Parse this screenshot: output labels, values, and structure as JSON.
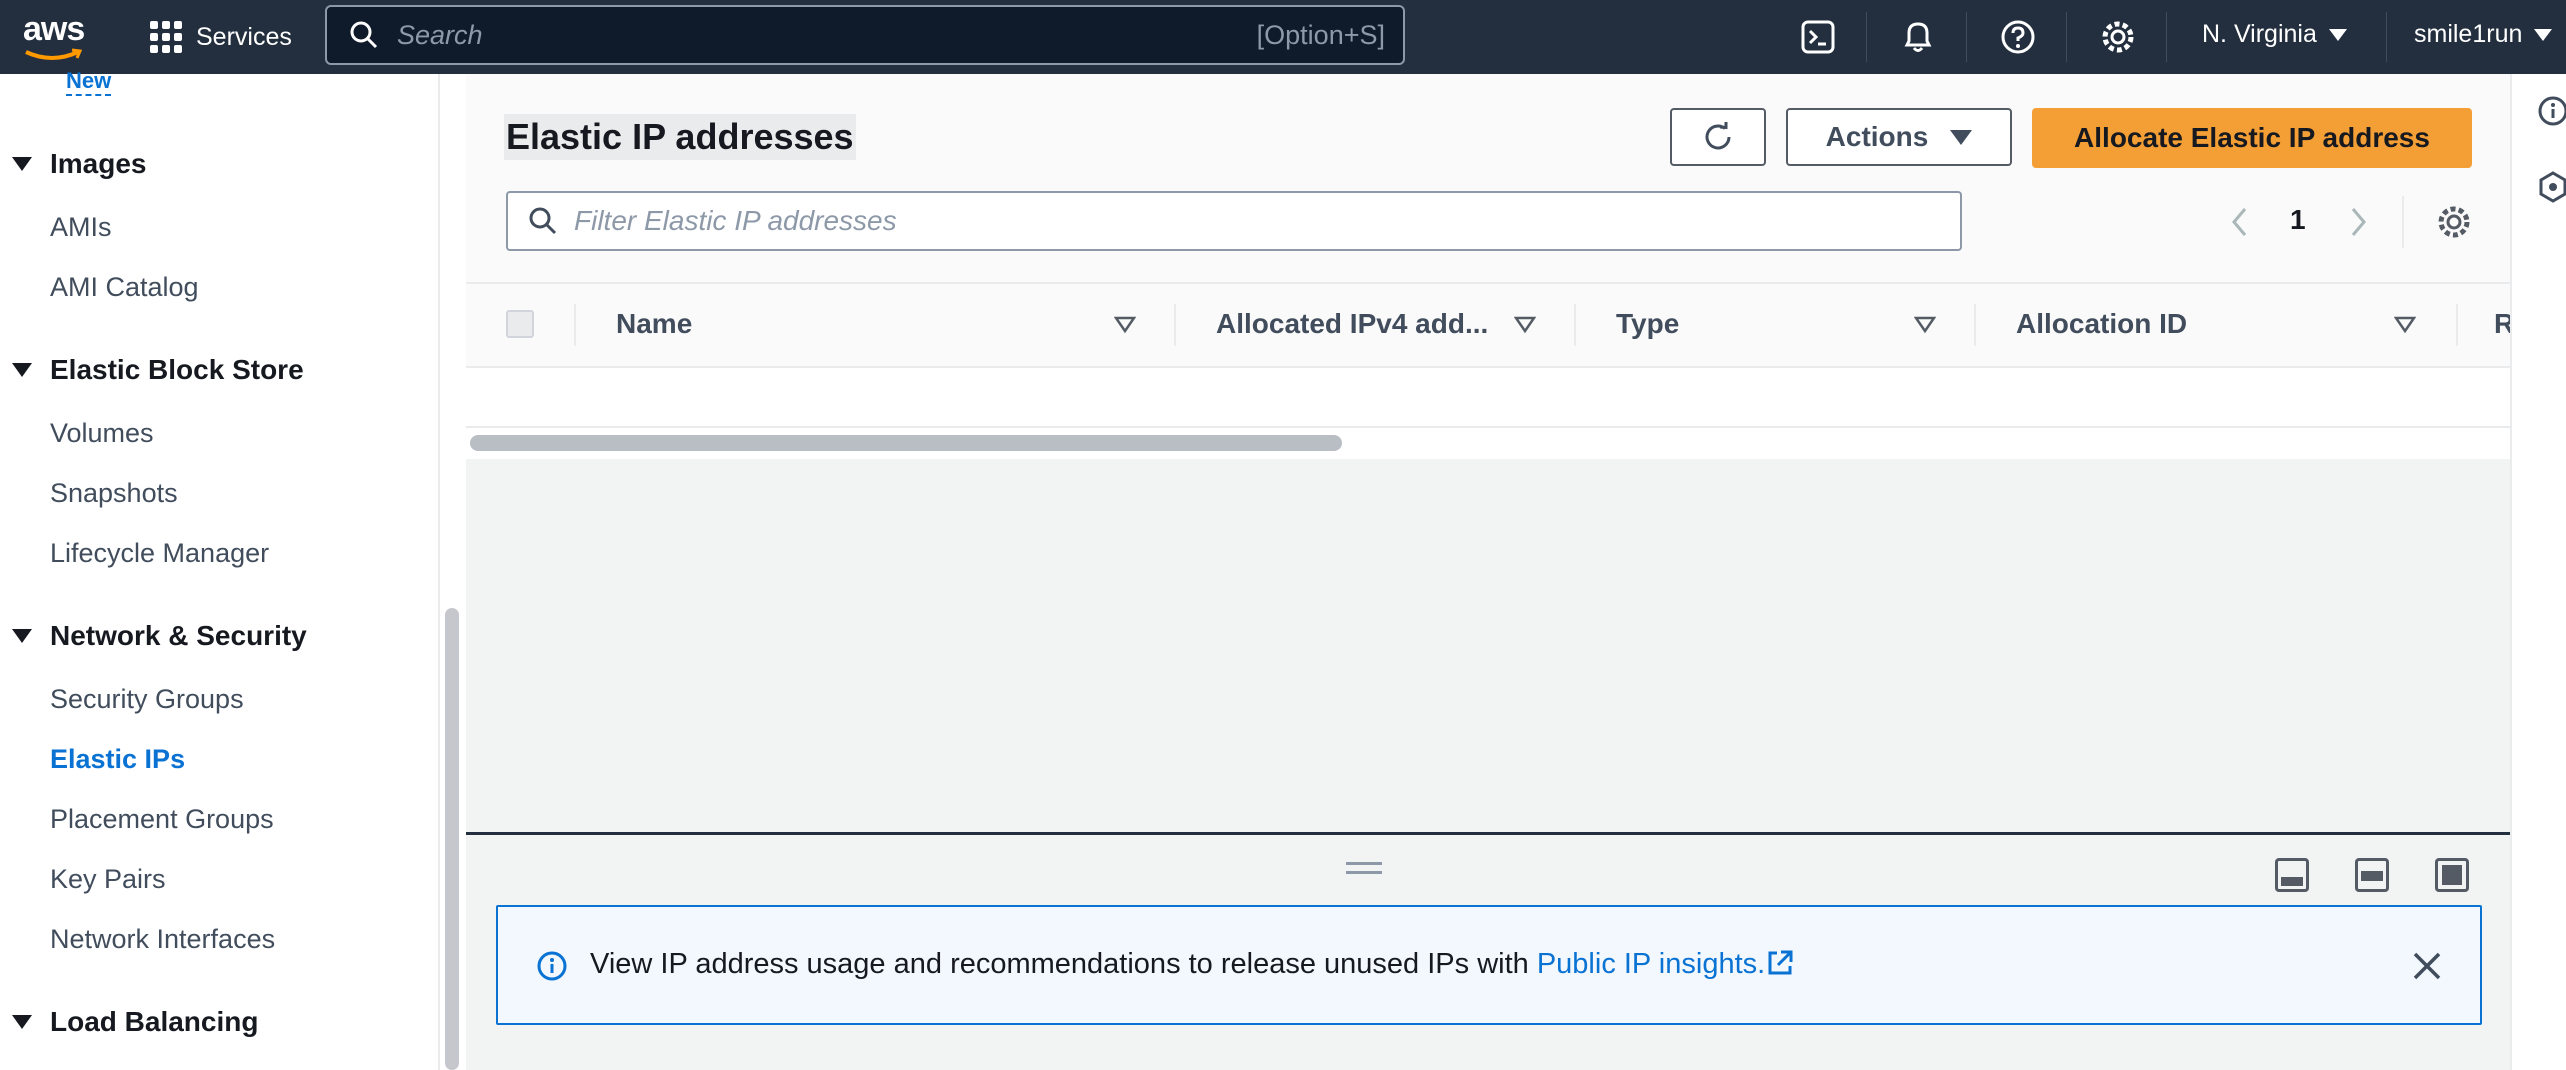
{
  "topnav": {
    "logo": "aws",
    "services_label": "Services",
    "search_placeholder": "Search",
    "search_shortcut": "[Option+S]",
    "region": "N. Virginia",
    "account": "smile1run",
    "icons": [
      "cloudshell-icon",
      "bell-icon",
      "help-icon",
      "settings-icon"
    ]
  },
  "sidebar": {
    "new_badge": "New",
    "sections": [
      {
        "header": "Images",
        "items": [
          "AMIs",
          "AMI Catalog"
        ]
      },
      {
        "header": "Elastic Block Store",
        "items": [
          "Volumes",
          "Snapshots",
          "Lifecycle Manager"
        ]
      },
      {
        "header": "Network & Security",
        "items": [
          "Security Groups",
          "Elastic IPs",
          "Placement Groups",
          "Key Pairs",
          "Network Interfaces"
        ]
      },
      {
        "header": "Load Balancing",
        "items": []
      }
    ],
    "active_item": "Elastic IPs"
  },
  "main": {
    "title": "Elastic IP addresses",
    "actions_label": "Actions",
    "allocate_label": "Allocate Elastic IP address",
    "filter_placeholder": "Filter Elastic IP addresses",
    "page_number": "1",
    "columns": [
      "Name",
      "Allocated IPv4 add...",
      "Type",
      "Allocation ID",
      "R"
    ]
  },
  "split_panel": {
    "alert_text": "View IP address usage and recommendations to release unused IPs with ",
    "alert_link": "Public IP insights."
  },
  "colors": {
    "nav_bg": "#232f3e",
    "primary": "#f49f35",
    "link": "#0972d3"
  }
}
